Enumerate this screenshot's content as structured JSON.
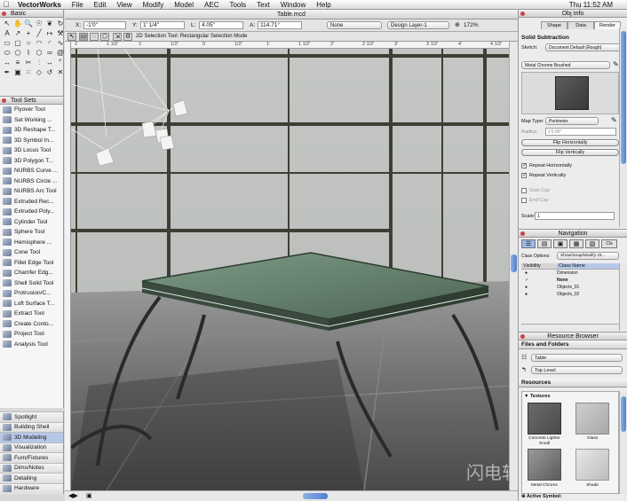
{
  "menubar": {
    "app_name": "VectorWorks",
    "items": [
      "File",
      "Edit",
      "View",
      "Modify",
      "Model",
      "AEC",
      "Tools",
      "Text",
      "Window",
      "Help"
    ],
    "clock": "Thu 11:52 AM"
  },
  "tool_palette": {
    "title": "Basic",
    "tool_sets_title": "Tool Sets",
    "tools": [
      "Flyover Tool",
      "Set Working ...",
      "3D Reshape T...",
      "3D Symbol In...",
      "3D Locus Tool",
      "3D Polygon T...",
      "NURBS Curve ...",
      "NURBS Circle ...",
      "NURBS Arc Tool",
      "Extruded Rec...",
      "Extruded Poly...",
      "Cylinder Tool",
      "Sphere Tool",
      "Hemisphere ...",
      "Cone Tool",
      "Fillet Edge Tool",
      "Chamfer Edg...",
      "Shell Solid Tool",
      "Protrusion/C...",
      "Loft Surface T...",
      "Extract Tool",
      "Create Conto...",
      "Project Tool",
      "Analysis Tool"
    ],
    "tool_sets": [
      "Spotlight",
      "Building Shell",
      "3D Modeling",
      "Visualization",
      "Furn/Fixtures",
      "Dims/Notes",
      "Detailing",
      "Hardware"
    ],
    "selected_tool_set": "3D Modeling"
  },
  "document": {
    "title": "Table.mcd",
    "x_label": "X:",
    "x_value": "-1'0\"",
    "y_label": "Y:",
    "y_value": "1' 1/4\"",
    "l_label": "L:",
    "l_value": "4.05\"",
    "a_label": "A:",
    "a_value": "114.71°",
    "class_dropdown": "None",
    "layer_dropdown": "Design Layer-1",
    "zoom": "172%",
    "mode_hint": "2D Selection Tool: Rectangular Selection Mode",
    "ruler_ticks": [
      "1'",
      "1 1/2'",
      "1'",
      "1/2'",
      "0",
      "1/2'",
      "1'",
      "1 1/2'",
      "2'",
      "2 1/2'",
      "3'",
      "3 1/2'",
      "4'",
      "4 1/2'"
    ],
    "watermark": "闪电软件"
  },
  "obj_info": {
    "title": "Obj Info",
    "tabs": [
      "Shape",
      "Data",
      "Render"
    ],
    "active_tab": "Render",
    "heading": "Solid Subtraction",
    "sketch_label": "Sketch:",
    "sketch_value": "Document Default (Rough)",
    "texture_value": "Metal Chrome Brushed",
    "map_type_label": "Map Type:",
    "map_type_value": "Perimeter",
    "radius_label": "Radius:",
    "radius_value": "1'0.00\"",
    "flip_h": "Flip Horizontally",
    "flip_v": "Flip Vertically",
    "repeat_h": "Repeat Horizontally",
    "repeat_v": "Repeat Vertically",
    "start_cap": "Start Cap",
    "end_cap": "End Cap",
    "scale_label": "Scale:",
    "scale_value": "1"
  },
  "navigation": {
    "title": "Navigation",
    "tab_cls": "Cls",
    "class_options_label": "Class Options:",
    "class_options_value": "Show/Snap/Modify Ot...",
    "col_visibility": "Visibility",
    "col_class": "Class Name",
    "rows": [
      "Dimension",
      "None",
      "Objects_01",
      "Objects_02"
    ]
  },
  "resource_browser": {
    "title": "Resource Browser",
    "files_heading": "Files and Folders",
    "file_value": "Table",
    "folder_value": "Top Level",
    "resources_heading": "Resources",
    "textures_label": "Textures",
    "swatches": [
      "Concrete Lighter Small",
      "Glass",
      "Metal Chrome",
      "Shade"
    ],
    "active_symbol_label": "Active Symbol:"
  },
  "colors": {
    "selection": "#b6c8e8",
    "scrollbar": "#4f7fd0",
    "glass": "#5e7a66",
    "frame": "#3d3f34"
  }
}
